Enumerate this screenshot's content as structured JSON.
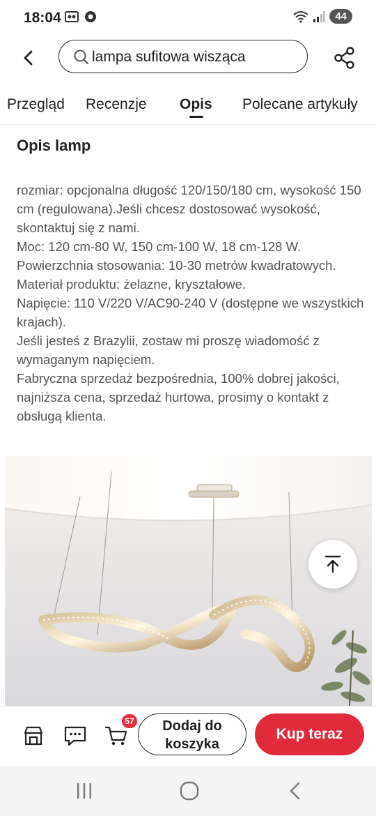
{
  "status": {
    "time": "18:04",
    "battery": "44"
  },
  "search": {
    "query": "lampa sufitowa wisząca"
  },
  "tabs": [
    {
      "label": "Przegląd"
    },
    {
      "label": "Recenzje"
    },
    {
      "label": "Opis"
    },
    {
      "label": "Polecane artykuły"
    }
  ],
  "description": {
    "title": "Opis lamp",
    "paragraphs": [
      "rozmiar: opcjonalna długość 120/150/180 cm, wysokość 150 cm (regulowana).Jeśli chcesz dostosować wysokość, skontaktuj się z nami.",
      "Moc: 120 cm-80 W, 150 cm-100 W, 18 cm-128 W.",
      "Powierzchnia stosowania: 10-30 metrów kwadratowych.",
      "Materiał produktu: żelazne, kryształowe.",
      "Napięcie: 110 V/220 V/AC90-240 V (dostępne we wszystkich krajach).",
      "Jeśli jesteś z Brazylii, zostaw mi proszę wiadomość z wymaganym napięciem.",
      "Fabryczna sprzedaż bezpośrednia, 100% dobrej jakości, najniższa cena, sprzedaż hurtowa, prosimy o kontakt z obsługą klienta."
    ]
  },
  "bottom": {
    "cart_count": "57",
    "add_to_cart": "Dodaj do koszyka",
    "buy_now": "Kup teraz"
  },
  "colors": {
    "accent": "#e02b3c",
    "text": "#222222",
    "muted": "#555555"
  },
  "icons": [
    "back-icon",
    "search-icon",
    "share-icon",
    "store-icon",
    "chat-icon",
    "cart-icon",
    "arrow-up-icon"
  ]
}
